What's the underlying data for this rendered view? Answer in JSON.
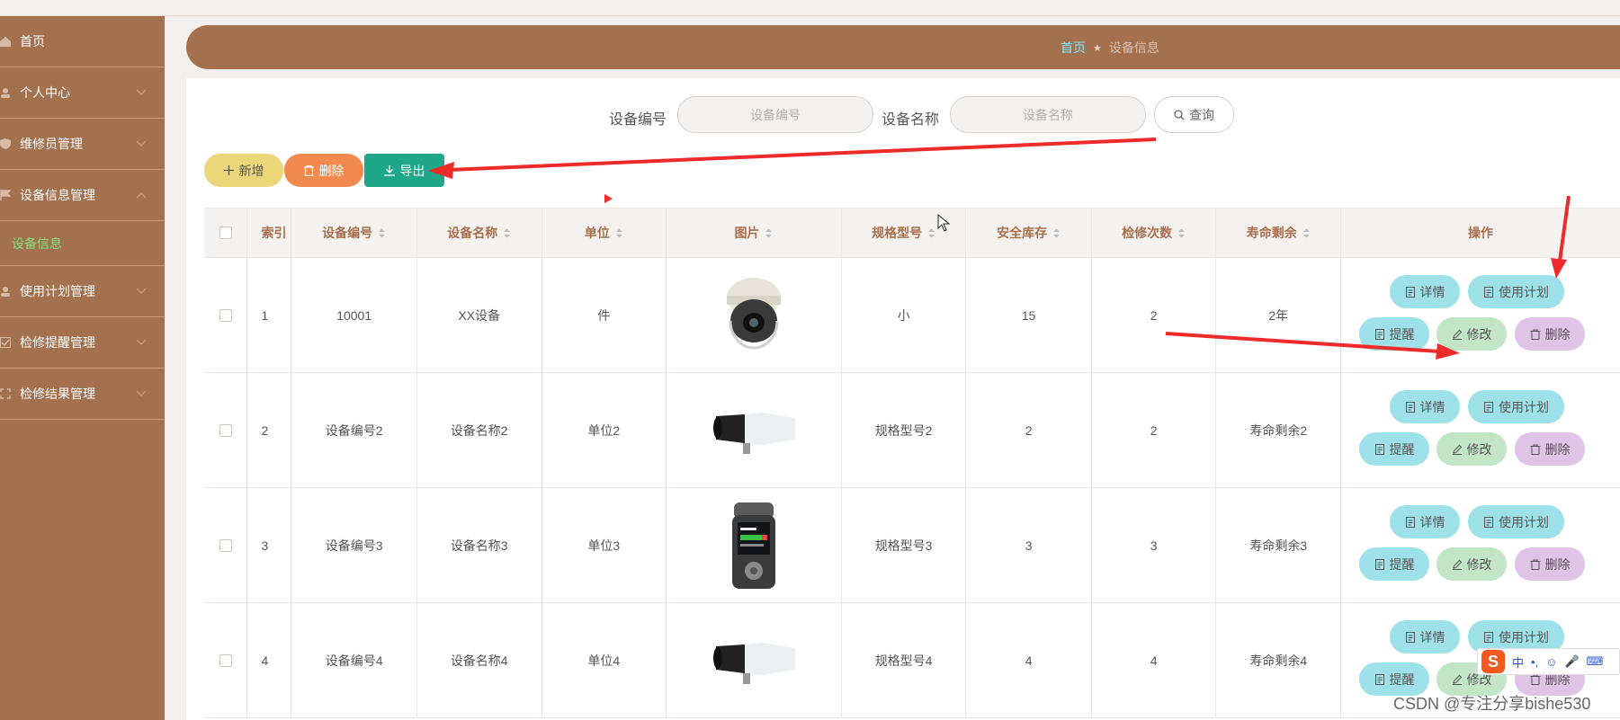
{
  "sidebar": {
    "items": [
      {
        "label": "首页",
        "icon": "home-icon"
      },
      {
        "label": "个人中心",
        "icon": "user-icon"
      },
      {
        "label": "维修员管理",
        "icon": "shield-icon"
      },
      {
        "label": "设备信息管理",
        "icon": "flag-icon"
      },
      {
        "label": "使用计划管理",
        "icon": "user-icon"
      },
      {
        "label": "检修提醒管理",
        "icon": "check-icon"
      },
      {
        "label": "检修结果管理",
        "icon": "frame-icon"
      }
    ],
    "sub_item": "设备信息"
  },
  "breadcrumb": {
    "home": "首页",
    "separator": "★",
    "current": "设备信息"
  },
  "search": {
    "code_label": "设备编号",
    "code_placeholder": "设备编号",
    "name_label": "设备名称",
    "name_placeholder": "设备名称",
    "query_label": "查询"
  },
  "toolbar": {
    "add_label": "新增",
    "delete_label": "删除",
    "export_label": "导出"
  },
  "table": {
    "headers": [
      "索引",
      "设备编号",
      "设备名称",
      "单位",
      "图片",
      "规格型号",
      "安全库存",
      "检修次数",
      "寿命剩余",
      "操作"
    ],
    "rows": [
      {
        "index": "1",
        "code": "10001",
        "name": "XX设备",
        "unit": "件",
        "image": "dome-camera",
        "spec": "小",
        "stock": "15",
        "repairs": "2",
        "life": "2年"
      },
      {
        "index": "2",
        "code": "设备编号2",
        "name": "设备名称2",
        "unit": "单位2",
        "image": "bullet-camera",
        "spec": "规格型号2",
        "stock": "2",
        "repairs": "2",
        "life": "寿命剩余2"
      },
      {
        "index": "3",
        "code": "设备编号3",
        "name": "设备名称3",
        "unit": "单位3",
        "image": "voice-recorder",
        "spec": "规格型号3",
        "stock": "3",
        "repairs": "3",
        "life": "寿命剩余3"
      },
      {
        "index": "4",
        "code": "设备编号4",
        "name": "设备名称4",
        "unit": "单位4",
        "image": "bullet-camera",
        "spec": "规格型号4",
        "stock": "4",
        "repairs": "4",
        "life": "寿命剩余4"
      }
    ],
    "ops": {
      "detail": "详情",
      "plan": "使用计划",
      "remind": "提醒",
      "edit": "修改",
      "delete": "删除"
    }
  },
  "ime": {
    "logo": "S",
    "mode": "中"
  },
  "watermark": "CSDN @专注分享bishe530",
  "colors": {
    "sidebar": "#a4714f",
    "accent_green": "#1ea889",
    "header_text": "#a86f4e",
    "annotation": "#ee2a2a"
  }
}
